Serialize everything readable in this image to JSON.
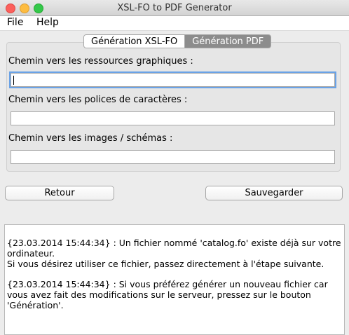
{
  "window": {
    "title": "XSL-FO to PDF Generator"
  },
  "menu": {
    "items": [
      "File",
      "Help"
    ]
  },
  "tabs": [
    {
      "label": "Génération XSL-FO"
    },
    {
      "label": "Génération PDF"
    }
  ],
  "form": {
    "graphics_label": "Chemin vers les ressources graphiques :",
    "graphics_value": "",
    "fonts_label": "Chemin vers les polices de caractères :",
    "fonts_value": "",
    "images_label": "Chemin vers les images / schémas :",
    "images_value": ""
  },
  "buttons": {
    "back": "Retour",
    "save": "Sauvegarder"
  },
  "log": {
    "messages": [
      "{23.03.2014 15:44:34} : Un fichier nommé 'catalog.fo' existe déjà sur votre ordinateur.\nSi vous désirez utiliser ce fichier, passez directement à l'étape suivante.",
      "{23.03.2014 15:44:34} : Si vous préférez générer un nouveau fichier car vous avez fait des modifications sur le serveur, pressez sur le bouton 'Génération'."
    ]
  },
  "colors": {
    "accent_focus": "#6aa2e6",
    "active_tab": "#ffffff",
    "inactive_tab": "#8c8c8c"
  }
}
